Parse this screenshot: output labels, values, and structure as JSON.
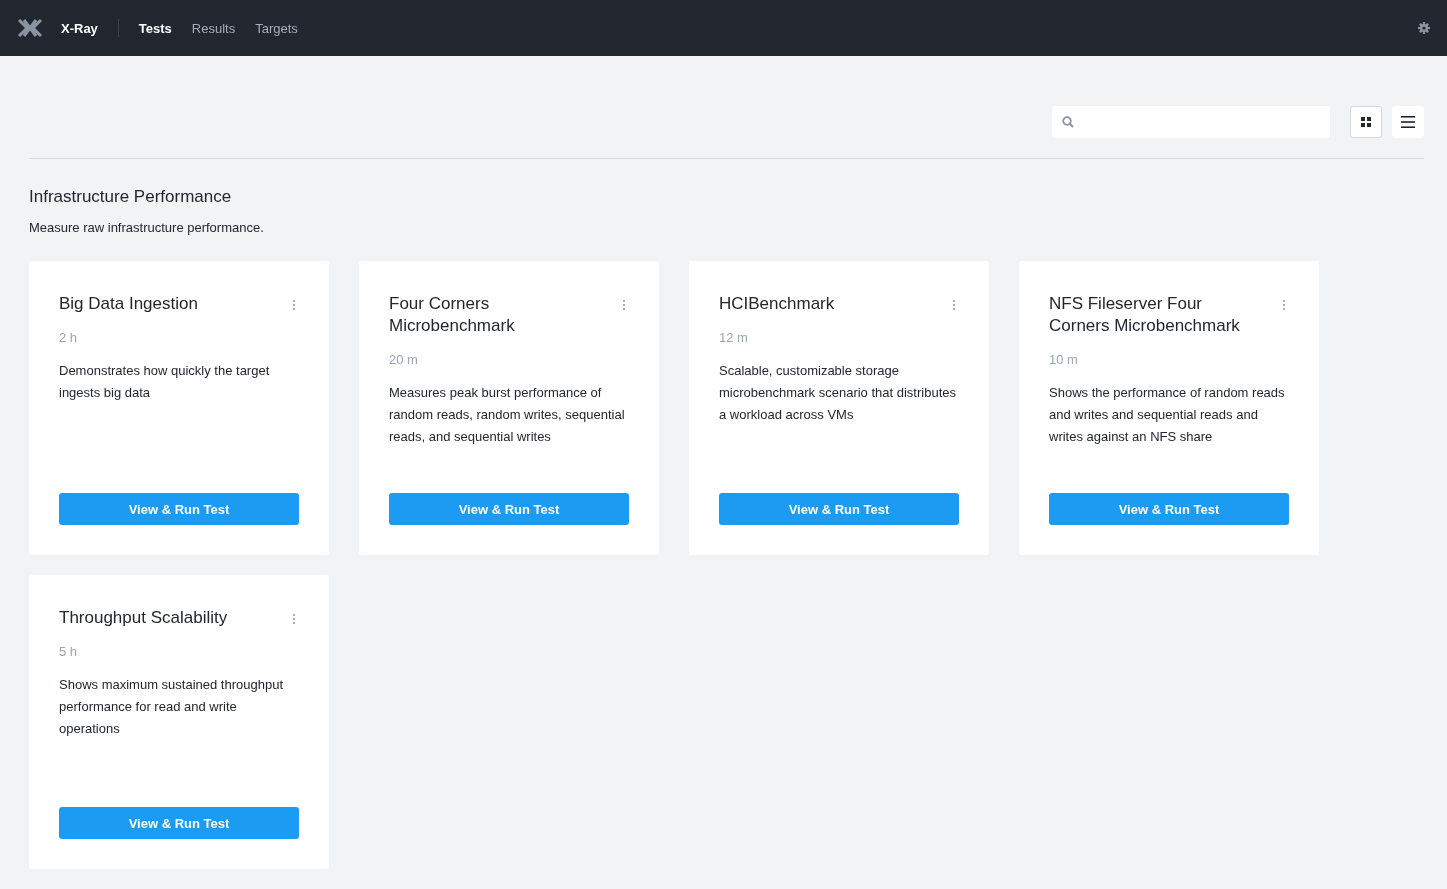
{
  "app": {
    "name": "X-Ray"
  },
  "nav": [
    {
      "label": "Tests",
      "selected": true
    },
    {
      "label": "Results",
      "selected": false
    },
    {
      "label": "Targets",
      "selected": false
    }
  ],
  "toolbar": {
    "views": [
      {
        "kind": "grid",
        "selected": true
      },
      {
        "kind": "list",
        "selected": false
      }
    ]
  },
  "section": {
    "title": "Infrastructure Performance",
    "description": "Measure raw infrastructure performance."
  },
  "tests": [
    {
      "title": "Big Data Ingestion",
      "duration": "2 h",
      "description": "Demonstrates how quickly the target ingests big data",
      "button": "View & Run Test"
    },
    {
      "title": "Four Corners Microbenchmark",
      "duration": "20 m",
      "description": "Measures peak burst performance of random reads, random writes, sequential reads, and sequential writes",
      "button": "View & Run Test"
    },
    {
      "title": "HCIBenchmark",
      "duration": "12 m",
      "description": "Scalable, customizable storage microbenchmark scenario that distributes a workload across VMs",
      "button": "View & Run Test"
    },
    {
      "title": "NFS Fileserver Four Corners Microbenchmark",
      "duration": "10 m",
      "description": "Shows the performance of random reads and writes and sequential reads and writes against an NFS share",
      "button": "View & Run Test"
    },
    {
      "title": "Throughput Scalability",
      "duration": "5 h",
      "description": "Shows maximum sustained throughput performance for read and write operations",
      "button": "View & Run Test"
    }
  ]
}
